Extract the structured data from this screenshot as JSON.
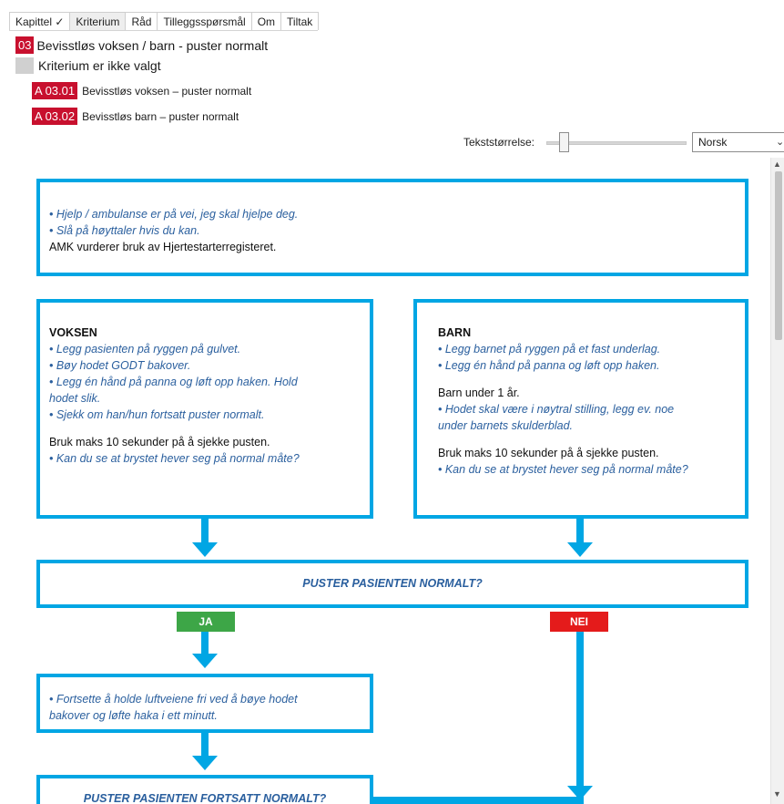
{
  "tabs": [
    {
      "label": "Kapittel ✓"
    },
    {
      "label": "Kriterium"
    },
    {
      "label": "Råd"
    },
    {
      "label": "Tilleggsspørsmål"
    },
    {
      "label": "Om"
    },
    {
      "label": "Tiltak"
    }
  ],
  "chapter": {
    "code": "03",
    "title": "Bevisstløs voksen / barn - puster normalt"
  },
  "criterion_status": "Kriterium er ikke valgt",
  "criteria": [
    {
      "code": "A 03.01",
      "text": "Bevisstløs voksen – puster normalt"
    },
    {
      "code": "A 03.02",
      "text": "Bevisstløs barn – puster normalt"
    }
  ],
  "text_size": {
    "label": "Tekststørrelse:",
    "level": 0.1
  },
  "language": {
    "selected": "Norsk"
  },
  "flowchart": {
    "intro": {
      "line1": "• Hjelp / ambulanse er på vei, jeg skal hjelpe deg.",
      "line2": "• Slå på høyttaler hvis du kan.",
      "line3": "AMK vurderer bruk av Hjertestarterregisteret."
    },
    "adult": {
      "heading": "VOKSEN",
      "l1": "• Legg pasienten på ryggen på gulvet.",
      "l2": "• Bøy hodet GODT bakover.",
      "l3a": "• Legg én hånd på panna og løft opp haken. Hold",
      "l3b": "hodet slik.",
      "l4": "• Sjekk om han/hun fortsatt puster normalt.",
      "l5": "Bruk maks 10 sekunder på å sjekke pusten.",
      "l6": "• Kan du se at brystet hever seg på normal måte?"
    },
    "child": {
      "heading": "BARN",
      "l1": "• Legg barnet på ryggen på et fast underlag.",
      "l2": "• Legg én hånd på panna og løft opp haken.",
      "l3": "Barn under 1 år.",
      "l4a": "• Hodet skal være i nøytral stilling, legg ev. noe",
      "l4b": "under barnets skulderblad.",
      "l5": "Bruk maks 10 sekunder på å sjekke pusten.",
      "l6": "• Kan du se at brystet hever seg på normal måte?"
    },
    "question1": "PUSTER PASIENTEN NORMALT?",
    "yes_label": "JA",
    "no_label": "NEI",
    "continue": {
      "l1": "• Fortsette å holde luftveiene fri ved å bøye hodet",
      "l2": "bakover og løfte haka i ett minutt."
    },
    "question2": "PUSTER PASIENTEN FORTSATT NORMALT?"
  },
  "colors": {
    "accent": "#00a6e4",
    "code_red": "#c8102e",
    "yes_green": "#3da647",
    "no_red": "#e41b1b",
    "italic_blue": "#2a5f9e"
  }
}
